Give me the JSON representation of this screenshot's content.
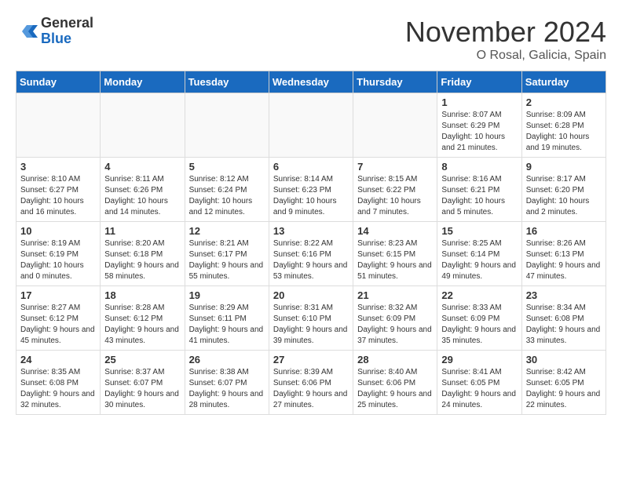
{
  "header": {
    "logo_general": "General",
    "logo_blue": "Blue",
    "month_title": "November 2024",
    "location": "O Rosal, Galicia, Spain"
  },
  "weekdays": [
    "Sunday",
    "Monday",
    "Tuesday",
    "Wednesday",
    "Thursday",
    "Friday",
    "Saturday"
  ],
  "weeks": [
    [
      {
        "day": "",
        "info": ""
      },
      {
        "day": "",
        "info": ""
      },
      {
        "day": "",
        "info": ""
      },
      {
        "day": "",
        "info": ""
      },
      {
        "day": "",
        "info": ""
      },
      {
        "day": "1",
        "info": "Sunrise: 8:07 AM\nSunset: 6:29 PM\nDaylight: 10 hours and 21 minutes."
      },
      {
        "day": "2",
        "info": "Sunrise: 8:09 AM\nSunset: 6:28 PM\nDaylight: 10 hours and 19 minutes."
      }
    ],
    [
      {
        "day": "3",
        "info": "Sunrise: 8:10 AM\nSunset: 6:27 PM\nDaylight: 10 hours and 16 minutes."
      },
      {
        "day": "4",
        "info": "Sunrise: 8:11 AM\nSunset: 6:26 PM\nDaylight: 10 hours and 14 minutes."
      },
      {
        "day": "5",
        "info": "Sunrise: 8:12 AM\nSunset: 6:24 PM\nDaylight: 10 hours and 12 minutes."
      },
      {
        "day": "6",
        "info": "Sunrise: 8:14 AM\nSunset: 6:23 PM\nDaylight: 10 hours and 9 minutes."
      },
      {
        "day": "7",
        "info": "Sunrise: 8:15 AM\nSunset: 6:22 PM\nDaylight: 10 hours and 7 minutes."
      },
      {
        "day": "8",
        "info": "Sunrise: 8:16 AM\nSunset: 6:21 PM\nDaylight: 10 hours and 5 minutes."
      },
      {
        "day": "9",
        "info": "Sunrise: 8:17 AM\nSunset: 6:20 PM\nDaylight: 10 hours and 2 minutes."
      }
    ],
    [
      {
        "day": "10",
        "info": "Sunrise: 8:19 AM\nSunset: 6:19 PM\nDaylight: 10 hours and 0 minutes."
      },
      {
        "day": "11",
        "info": "Sunrise: 8:20 AM\nSunset: 6:18 PM\nDaylight: 9 hours and 58 minutes."
      },
      {
        "day": "12",
        "info": "Sunrise: 8:21 AM\nSunset: 6:17 PM\nDaylight: 9 hours and 55 minutes."
      },
      {
        "day": "13",
        "info": "Sunrise: 8:22 AM\nSunset: 6:16 PM\nDaylight: 9 hours and 53 minutes."
      },
      {
        "day": "14",
        "info": "Sunrise: 8:23 AM\nSunset: 6:15 PM\nDaylight: 9 hours and 51 minutes."
      },
      {
        "day": "15",
        "info": "Sunrise: 8:25 AM\nSunset: 6:14 PM\nDaylight: 9 hours and 49 minutes."
      },
      {
        "day": "16",
        "info": "Sunrise: 8:26 AM\nSunset: 6:13 PM\nDaylight: 9 hours and 47 minutes."
      }
    ],
    [
      {
        "day": "17",
        "info": "Sunrise: 8:27 AM\nSunset: 6:12 PM\nDaylight: 9 hours and 45 minutes."
      },
      {
        "day": "18",
        "info": "Sunrise: 8:28 AM\nSunset: 6:12 PM\nDaylight: 9 hours and 43 minutes."
      },
      {
        "day": "19",
        "info": "Sunrise: 8:29 AM\nSunset: 6:11 PM\nDaylight: 9 hours and 41 minutes."
      },
      {
        "day": "20",
        "info": "Sunrise: 8:31 AM\nSunset: 6:10 PM\nDaylight: 9 hours and 39 minutes."
      },
      {
        "day": "21",
        "info": "Sunrise: 8:32 AM\nSunset: 6:09 PM\nDaylight: 9 hours and 37 minutes."
      },
      {
        "day": "22",
        "info": "Sunrise: 8:33 AM\nSunset: 6:09 PM\nDaylight: 9 hours and 35 minutes."
      },
      {
        "day": "23",
        "info": "Sunrise: 8:34 AM\nSunset: 6:08 PM\nDaylight: 9 hours and 33 minutes."
      }
    ],
    [
      {
        "day": "24",
        "info": "Sunrise: 8:35 AM\nSunset: 6:08 PM\nDaylight: 9 hours and 32 minutes."
      },
      {
        "day": "25",
        "info": "Sunrise: 8:37 AM\nSunset: 6:07 PM\nDaylight: 9 hours and 30 minutes."
      },
      {
        "day": "26",
        "info": "Sunrise: 8:38 AM\nSunset: 6:07 PM\nDaylight: 9 hours and 28 minutes."
      },
      {
        "day": "27",
        "info": "Sunrise: 8:39 AM\nSunset: 6:06 PM\nDaylight: 9 hours and 27 minutes."
      },
      {
        "day": "28",
        "info": "Sunrise: 8:40 AM\nSunset: 6:06 PM\nDaylight: 9 hours and 25 minutes."
      },
      {
        "day": "29",
        "info": "Sunrise: 8:41 AM\nSunset: 6:05 PM\nDaylight: 9 hours and 24 minutes."
      },
      {
        "day": "30",
        "info": "Sunrise: 8:42 AM\nSunset: 6:05 PM\nDaylight: 9 hours and 22 minutes."
      }
    ]
  ]
}
